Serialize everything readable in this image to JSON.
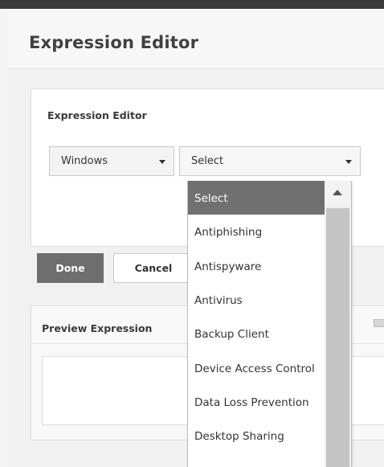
{
  "header": {
    "title": "Expression Editor"
  },
  "editor": {
    "title": "Expression Editor",
    "os_select": {
      "value": "Windows"
    },
    "category_select": {
      "value": "Select"
    }
  },
  "buttons": {
    "done": "Done",
    "cancel": "Cancel"
  },
  "preview": {
    "title": "Preview Expression"
  },
  "dropdown": {
    "selected_index": 0,
    "options": [
      "Select",
      "Antiphishing",
      "Antispyware",
      "Antivirus",
      "Backup Client",
      "Device Access Control",
      "Data Loss Prevention",
      "Desktop Sharing"
    ]
  }
}
